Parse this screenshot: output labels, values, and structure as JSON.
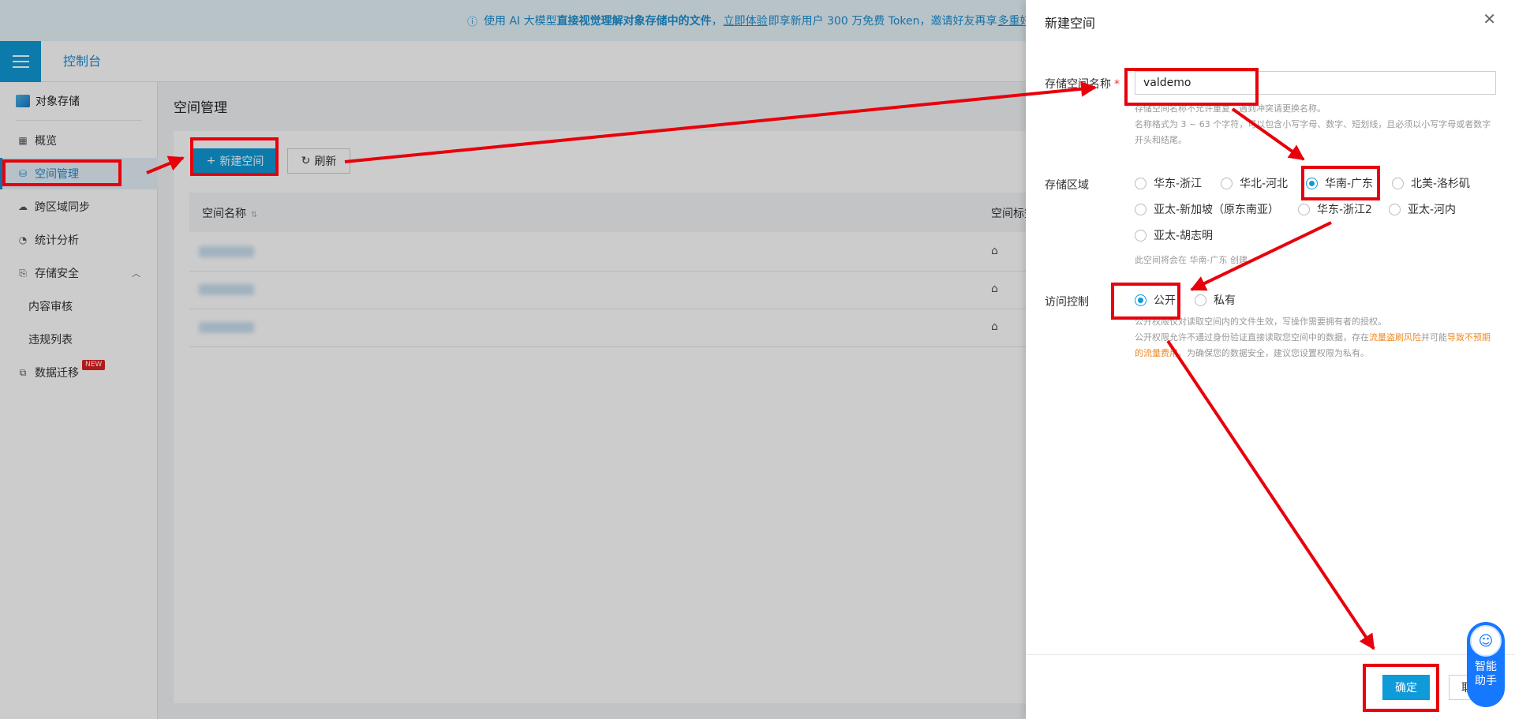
{
  "banner": {
    "icon": "info-circle-icon",
    "text_before": "使用 AI 大模型",
    "bold": "直接视觉理解对象存储中的文件",
    "comma": "，",
    "link": "立即体验",
    "text_after": "即享新用户 300 万免费 Token，邀请好友再享",
    "link2": "多重好"
  },
  "topbar": {
    "console_label": "控制台"
  },
  "sidebar": {
    "title": "对象存储",
    "items": [
      {
        "label": "概览",
        "icon": "grid-icon"
      },
      {
        "label": "空间管理",
        "icon": "database-icon",
        "active": true
      },
      {
        "label": "跨区域同步",
        "icon": "cloud-sync-icon"
      },
      {
        "label": "统计分析",
        "icon": "pie-chart-icon"
      },
      {
        "label": "存储安全",
        "icon": "security-file-icon"
      },
      {
        "label": "内容审核"
      },
      {
        "label": "违规列表"
      },
      {
        "label": "数据迁移",
        "icon": "migrate-icon",
        "badge": "NEW"
      }
    ]
  },
  "main": {
    "title": "空间管理",
    "new_button": "新建空间",
    "refresh_button": "刷新",
    "columns": [
      "空间名称",
      "空间标签"
    ]
  },
  "drawer": {
    "title": "新建空间",
    "name_label": "存储空间名称",
    "required_mark": "*",
    "name_value": "valdemo",
    "name_hint_1": "存储空间名称不允许重复，遇到冲突请更换名称。",
    "name_hint_2": "名称格式为 3 ~ 63 个字符，可以包含小写字母、数字、短划线，且必须以小写字母或者数字开头和结尾。",
    "region_label": "存储区域",
    "regions": [
      "华东-浙江",
      "华北-河北",
      "华南-广东",
      "北美-洛杉矶",
      "亚太-新加坡（原东南亚）",
      "华东-浙江2",
      "亚太-河内",
      "亚太-胡志明"
    ],
    "region_selected": "华南-广东",
    "region_hint": "此空间将会在 华南-广东 创建。",
    "access_label": "访问控制",
    "access_options": [
      "公开",
      "私有"
    ],
    "access_selected": "公开",
    "access_hint_1": "公开权限仅对读取空间内的文件生效，写操作需要拥有者的授权。",
    "access_hint_2a": "公开权限允许不通过身份验证直接读取您空间中的数据，存在",
    "access_hint_2b": "流量盗刷风险",
    "access_hint_2c": "并可能",
    "access_hint_2d": "导致不预期的流量费用",
    "access_hint_2e": "。为确保您的数据安全，建议您设置权限为私有。",
    "ok_button": "确定",
    "cancel_button": "取消"
  },
  "assistant": {
    "label_line1": "智能",
    "label_line2": "助手",
    "icon": "robot-icon"
  },
  "colors": {
    "accent": "#0f9ad8",
    "annotation_red": "#e8000b",
    "warning_orange": "#f08a24",
    "assistant_blue": "#1677ff"
  }
}
